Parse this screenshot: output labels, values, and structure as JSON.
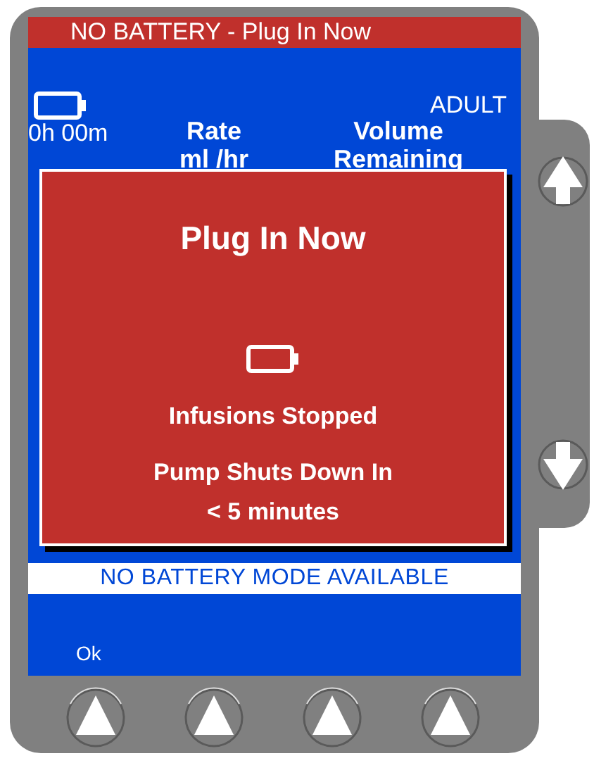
{
  "title_bar": {
    "text": "NO BATTERY - Plug In Now"
  },
  "status": {
    "battery_time": "0h 00m",
    "patient_type": "ADULT"
  },
  "columns": [
    {
      "heading": "Rate",
      "subheading": "ml /hr"
    },
    {
      "heading": "Volume",
      "subheading": "Remaining"
    }
  ],
  "alert": {
    "title": "Plug In Now",
    "message": "Infusions Stopped",
    "detail_lines": [
      "Pump Shuts Down In",
      "< 5 minutes"
    ]
  },
  "banner": {
    "text": "NO BATTERY MODE AVAILABLE"
  },
  "softkeys": [
    {
      "label": "Ok"
    }
  ]
}
